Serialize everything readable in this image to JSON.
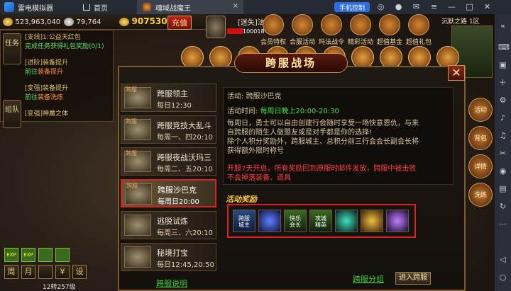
{
  "emulator": {
    "app_name": "雷电模拟器",
    "home_label": "首页",
    "tab_title": "魂域战魔王",
    "tab_close": "×",
    "controls_label": "手机控制"
  },
  "hud": {
    "gold": "523,963,040",
    "silver": "79,764",
    "yuanbao": "907530",
    "charge_label": "充值",
    "server_zone": "沉默之路 1区",
    "hp_value": "100018",
    "player_name": "[迷失]法"
  },
  "tasks": [
    {
      "title": "[支线]1:公益天红包",
      "sub": "完成任务获得礼包奖励(0/1)"
    },
    {
      "title": "[进阶]装备提升",
      "sub_prefix": "前往",
      "sub_link": "装备提升"
    },
    {
      "title": "[变强]装备提升",
      "sub_prefix": "前往",
      "sub_link": "装备洗炼"
    },
    {
      "title": "[变强]神魔之体",
      "sub": ""
    }
  ],
  "left_tabs": {
    "task": "任务",
    "team": "组队"
  },
  "top_icons": [
    {
      "label": "会员特权"
    },
    {
      "label": "合服活动"
    },
    {
      "label": "玛法战令"
    },
    {
      "label": "精彩活动"
    },
    {
      "label": "超值基金"
    },
    {
      "label": "超值礼包"
    }
  ],
  "dialog": {
    "title": "跨服战场",
    "close": "✕"
  },
  "events": [
    {
      "tag": "跨服",
      "name": "跨服领主",
      "time": "每日12:30"
    },
    {
      "tag": "跨服",
      "name": "跨服竞技大乱斗",
      "time": "每周一、四20:10"
    },
    {
      "tag": "跨服",
      "name": "跨服夜战沃玛三",
      "time": "每周二、五20:10"
    },
    {
      "tag": "跨服",
      "name": "跨服沙巴克",
      "time": "每周日20:00"
    },
    {
      "tag": "",
      "name": "逃脱试炼",
      "time": "每周三、六20:10"
    },
    {
      "tag": "",
      "name": "秘境打宝",
      "time": "每日12:45,20:50"
    }
  ],
  "detail": {
    "activity_label": "活动:",
    "activity_name": "跨服沙巴克",
    "time_label": "活动时间:",
    "time_value": "每周日晚上20:00-20:30",
    "desc_lines": [
      "每周日，勇士可以自由创建行会随时享受一场快意恩仇，与来",
      "自跨服的陌生人做盟友或是对手都是你的选择!",
      "除个人积分奖励外，跨服城主、总积分前三行会会长副会长将",
      "获得额外限时称号"
    ],
    "warn_lines": [
      "开服7天开启，所有奖励回到原服时邮件发放，跨服中被击败",
      "不会掉落装备、道具"
    ],
    "reward_title": "活动奖励"
  },
  "rewards": [
    {
      "text": "跨服\n城主"
    },
    {
      "text": ""
    },
    {
      "text": "快乐\n会长"
    },
    {
      "text": "攻城\n精英"
    },
    {
      "text": ""
    },
    {
      "text": ""
    },
    {
      "text": ""
    }
  ],
  "footer": {
    "explain_link": "跨服说明",
    "group_link": "跨服分组",
    "enter_button": "进入跨服",
    "level_text": "12转257级"
  },
  "bottom_buttons": [
    "周",
    "月",
    "",
    "¥",
    "设"
  ],
  "right_column": [
    "活动",
    "背包",
    "详情",
    "洗炼"
  ]
}
